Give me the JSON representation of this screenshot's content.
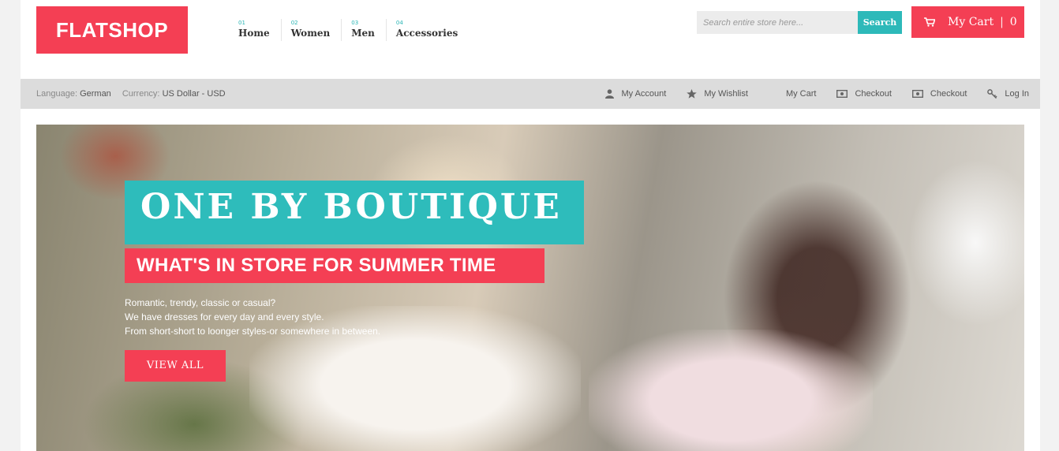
{
  "brand": {
    "logo": "FLATSHOP",
    "accent_color": "#f43f54",
    "teal_color": "#2ebcbb"
  },
  "nav": {
    "items": [
      {
        "num": "01",
        "label": "Home"
      },
      {
        "num": "02",
        "label": "Women"
      },
      {
        "num": "03",
        "label": "Men"
      },
      {
        "num": "04",
        "label": "Accessories"
      }
    ]
  },
  "search": {
    "placeholder": "Search entire store here...",
    "button_label": "Search",
    "icon": "search-icon"
  },
  "cart": {
    "label": "My Cart",
    "separator": "|",
    "count": "0",
    "icon": "cart-icon"
  },
  "infobar": {
    "language_label": "Language:",
    "language_value": "German",
    "currency_label": "Currency:",
    "currency_value": "US Dollar - USD",
    "links": [
      {
        "label": "My Account",
        "icon": "user-icon"
      },
      {
        "label": "My Wishlist",
        "icon": "star-icon"
      },
      {
        "label": "My Cart",
        "icon": "cart-icon"
      },
      {
        "label": "Checkout",
        "icon": "money-icon"
      },
      {
        "label": "Checkout",
        "icon": "money-icon"
      },
      {
        "label": "Log In",
        "icon": "key-icon"
      }
    ]
  },
  "hero": {
    "title": "ONE BY BOUTIQUE",
    "subtitle": "WHAT'S IN STORE FOR SUMMER TIME",
    "lines": [
      "Romantic, trendy, classic or casual?",
      "We have dresses for every day and every style.",
      "From short-short to loonger styles-or somewhere in between."
    ],
    "button_label": "VIEW ALL"
  }
}
